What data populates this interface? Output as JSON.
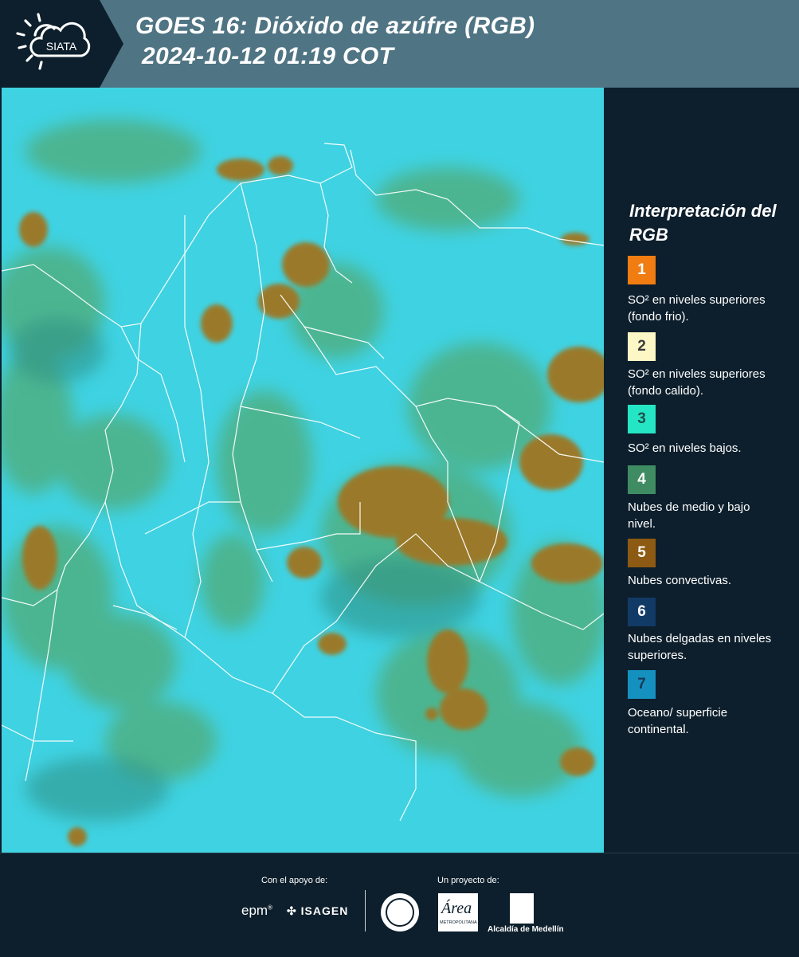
{
  "header": {
    "title_line1": "GOES 16: Dióxido de azúfre (RGB)",
    "title_line2": "2024-10-12 01:19 COT",
    "logo_text": "SIATA",
    "background_color": "#4f7483",
    "logo_background_color": "#0d1f2c"
  },
  "map": {
    "description_icon": "satellite-composite-map",
    "base_color": "#3fd2e2"
  },
  "legend": {
    "title": "Interpretación del RGB",
    "items": [
      {
        "number": "1",
        "label": "SO² en niveles superiores (fondo frio).",
        "color": "#f07c12",
        "text_color": "#ffffff"
      },
      {
        "number": "2",
        "label": "SO² en niveles superiores (fondo calido).",
        "color": "#fdf7c6",
        "text_color": "#3a3a3a"
      },
      {
        "number": "3",
        "label": "SO² en niveles bajos.",
        "color": "#25e6c4",
        "text_color": "#1f4f4a"
      },
      {
        "number": "4",
        "label": "Nubes de medio y bajo nivel.",
        "color": "#3f8c63",
        "text_color": "#ffffff"
      },
      {
        "number": "5",
        "label": "Nubes convectivas.",
        "color": "#8c5a12",
        "text_color": "#ffffff"
      },
      {
        "number": "6",
        "label": "Nubes delgadas en niveles superiores.",
        "color": "#123a66",
        "text_color": "#ffffff"
      },
      {
        "number": "7",
        "label": "Oceano/ superficie continental.",
        "color": "#1591bf",
        "text_color": "#1a3a55"
      }
    ]
  },
  "footer": {
    "support_label": "Con el apoyo de:",
    "project_label": "Un proyecto de:",
    "sponsor_epm": "epm",
    "sponsor_isagen": "ISAGEN",
    "area_label": "Área",
    "area_sub": "METROPOLITANA",
    "alcaldia_label": "Alcaldía de Medellín"
  }
}
